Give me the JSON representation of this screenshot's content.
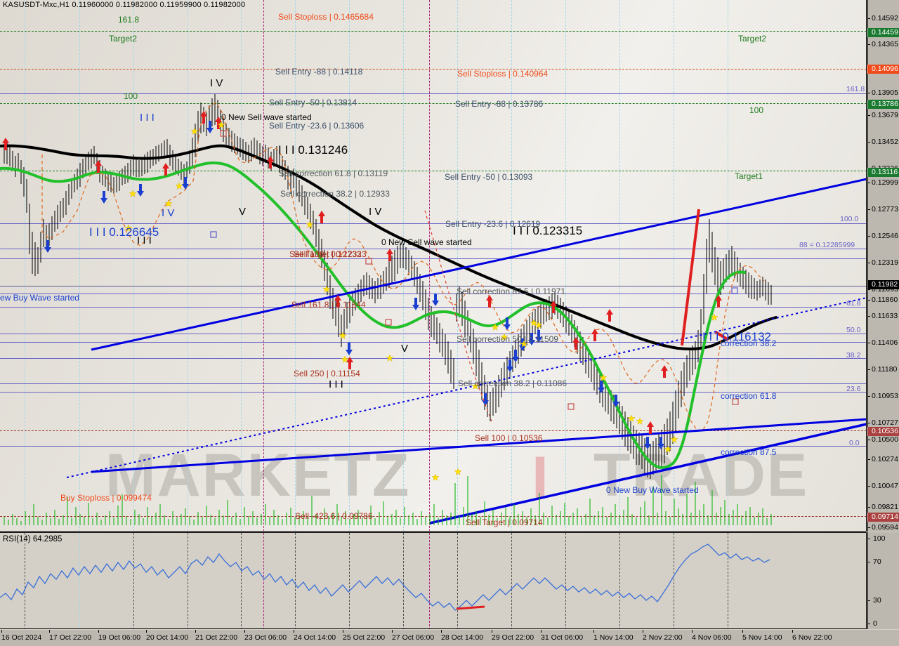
{
  "window": {
    "symbol_line": "KASUSDT-Mxc,H1  0.11960000 0.11982000 0.11959900 0.11982000"
  },
  "chart_data": {
    "type": "line",
    "title": "KASUSDT-Mxc,H1",
    "symbol": "KASUSDT-Mxc",
    "timeframe": "H1",
    "ohlc": {
      "open": "0.11960000",
      "high": "0.11982000",
      "low": "0.11959900",
      "close": "0.11982000"
    },
    "ylabel": "",
    "xlabel": "",
    "ylim": [
      0.09594,
      0.14592
    ],
    "price_ticks": [
      "0.14592",
      "0.14459",
      "0.14365",
      "0.14096",
      "0.13905",
      "0.13786",
      "0.13679",
      "0.13452",
      "0.13226",
      "0.13116",
      "0.12999",
      "0.12773",
      "0.12546",
      "0.12319",
      "0.12093",
      "0.11982",
      "0.11860",
      "0.11633",
      "0.11406",
      "0.11180",
      "0.10953",
      "0.10727",
      "0.10536",
      "0.10500",
      "0.10274",
      "0.10047",
      "0.09821",
      "0.09714",
      "0.09594"
    ],
    "highlight_ticks": {
      "green": [
        "0.14459",
        "0.13786",
        "0.13116"
      ],
      "orange": [
        "0.14096"
      ],
      "darkred": [
        "0.10536",
        "0.09714"
      ],
      "black": [
        "0.11982"
      ]
    },
    "time_ticks": [
      "16 Oct 2024",
      "17 Oct 22:00",
      "19 Oct 06:00",
      "20 Oct 14:00",
      "21 Oct 22:00",
      "23 Oct 06:00",
      "24 Oct 14:00",
      "25 Oct 22:00",
      "27 Oct 06:00",
      "28 Oct 14:00",
      "29 Oct 22:00",
      "31 Oct 06:00",
      "1 Nov 14:00",
      "2 Nov 22:00",
      "4 Nov 06:00",
      "5 Nov 14:00",
      "6 Nov 22:00"
    ],
    "indicator_subwindow": {
      "label": "RSI(14) 64.2985",
      "name": "RSI",
      "period": 14,
      "value": 64.2985,
      "levels": [
        "100",
        "70",
        "30",
        "0"
      ],
      "ylim": [
        0,
        100
      ]
    }
  },
  "annotations": {
    "levels_left": [
      {
        "text": "161.8",
        "color": "#1c7a1c"
      },
      {
        "text": "Target2",
        "color": "#1c7a1c"
      },
      {
        "text": "100",
        "color": "#1c7a1c"
      },
      {
        "text": "Target1",
        "color": "#1c7a1c"
      }
    ],
    "sell_labels": [
      {
        "text": "Sell Stoploss | 0.1465684",
        "color": "#f04a1a"
      },
      {
        "text": "Sell Entry -88 | 0.14118",
        "color": "#3c5068"
      },
      {
        "text": "Sell Entry -50 | 0.13814",
        "color": "#3c5068"
      },
      {
        "text": "Sell Entry -23.6 | 0.13606",
        "color": "#3c5068"
      },
      {
        "text": "Sell Stoploss | 0.140964",
        "color": "#f04a1a"
      },
      {
        "text": "Sell Entry -88 | 0.13786",
        "color": "#3c5068"
      },
      {
        "text": "Sell Entry -50 | 0.13093",
        "color": "#3c5068"
      },
      {
        "text": "Sell Entry -23.6 | 0.12619",
        "color": "#3c5068"
      },
      {
        "text": "Sell correction 61.8 | 0.13119",
        "color": "#50585c"
      },
      {
        "text": "Sell correction 38.2 | 0.12933",
        "color": "#50585c"
      },
      {
        "text": "Sell correction 87.5 | 0.11971",
        "color": "#50585c"
      },
      {
        "text": "Sell correction 50 | 0.11509",
        "color": "#50585c"
      },
      {
        "text": "Sell correction 38.2 | 0.11086",
        "color": "#50585c"
      },
      {
        "text": "Sell Target | 0.12323",
        "color": "#aa3322"
      },
      {
        "text": "Sell 100 | 0.12733",
        "color": "#aa3322"
      },
      {
        "text": "Sell 161.8 | 0.11844",
        "color": "#aa3322"
      },
      {
        "text": "Sell 250 | 0.11154",
        "color": "#aa3322"
      },
      {
        "text": "Sell 100 | 0.10536",
        "color": "#aa3322"
      },
      {
        "text": "Sell -423.6 | 0.09786",
        "color": "#aa3322"
      },
      {
        "text": "Sell Target | 0.09714",
        "color": "#aa3322"
      },
      {
        "text": "Buy Stoploss | 0.099474",
        "color": "#f04a1a"
      }
    ],
    "wave_labels": [
      {
        "text": "0 New Sell wave started",
        "color": "#000000"
      },
      {
        "text": "0 New Sell wave started",
        "color": "#000000"
      },
      {
        "text": "0 New Buy Wave started",
        "color": "#1a3fd0"
      },
      {
        "text": "ew Buy Wave started",
        "color": "#1a3fd0"
      },
      {
        "text": "I I I 0.126645",
        "color": "#1a3fd0"
      },
      {
        "text": "I I I 0.131246",
        "color": "#000000"
      },
      {
        "text": "I I I 0.123315",
        "color": "#000000"
      },
      {
        "text": "I I I 0.116132",
        "color": "#1a3fd0"
      },
      {
        "text": "I V",
        "color": "#000000"
      },
      {
        "text": "I V",
        "color": "#1a3fd0"
      },
      {
        "text": "I I I",
        "color": "#1a3fd0"
      },
      {
        "text": "I I I",
        "color": "#000000"
      },
      {
        "text": "I I I",
        "color": "#000000"
      },
      {
        "text": "V",
        "color": "#000000"
      },
      {
        "text": "V",
        "color": "#000000"
      },
      {
        "text": "I V",
        "color": "#000000"
      }
    ],
    "fib_levels_right": [
      {
        "text": "161.8",
        "color": "#6a63c8"
      },
      {
        "text": "100",
        "color": "#1c7a1c"
      },
      {
        "text": "100.0",
        "color": "#6a63c8"
      },
      {
        "text": "88 = 0.12285999",
        "color": "#6a63c8"
      },
      {
        "text": "61.8",
        "color": "#6a63c8"
      },
      {
        "text": "50.0",
        "color": "#6a63c8"
      },
      {
        "text": "38.2",
        "color": "#6a63c8"
      },
      {
        "text": "23.6",
        "color": "#6a63c8"
      },
      {
        "text": "0.0",
        "color": "#6a63c8"
      }
    ],
    "correction_labels": [
      {
        "text": "correction 38.2",
        "color": "#1a3fd0"
      },
      {
        "text": "correction 61.8",
        "color": "#1a3fd0"
      },
      {
        "text": "correction 87.5",
        "color": "#1a3fd0"
      }
    ],
    "watermark_main": "MARKETZ",
    "watermark_sub": "TRADE",
    "watermark_bar": "I"
  },
  "colors": {
    "bullish_arrow": "#1a3fd0",
    "bearish_arrow": "#e02020",
    "ma_fast": "#22c02a",
    "ma_slow": "#000000",
    "fib_line": "#6a63c8",
    "trend_line": "#0000e0",
    "target_line": "#1c7a1c",
    "stoploss_line": "#d2491a",
    "volume": "#00b000",
    "rsi_line": "#3a6fd8",
    "star": "#ffe000",
    "background": "#e4e1da",
    "axis_background": "#bcb8b0"
  }
}
